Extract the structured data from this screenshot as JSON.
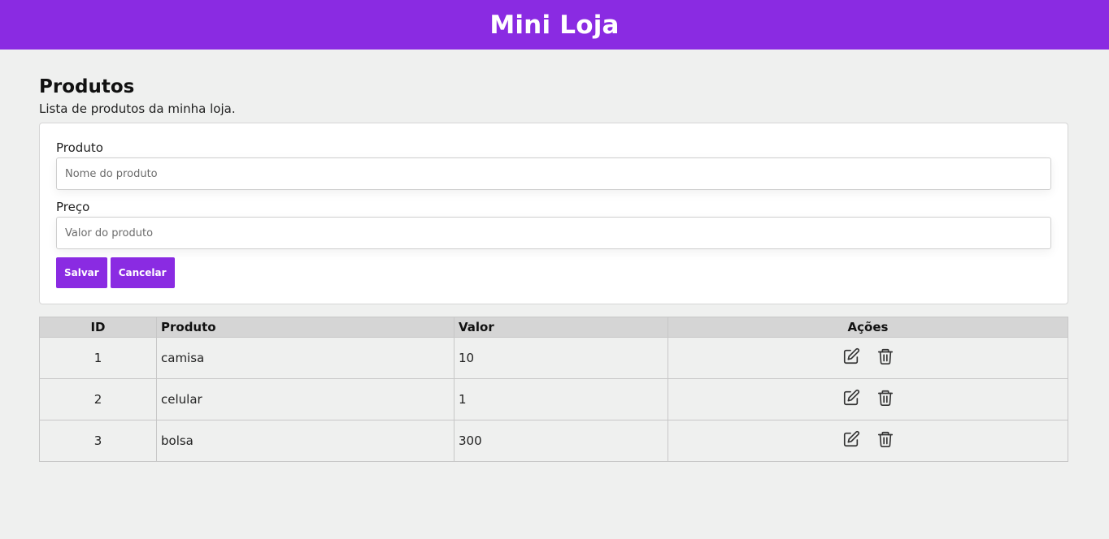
{
  "header": {
    "title": "Mini Loja"
  },
  "page": {
    "title": "Produtos",
    "subtitle": "Lista de produtos da minha loja."
  },
  "form": {
    "product_label": "Produto",
    "product_placeholder": "Nome do produto",
    "product_value": "",
    "price_label": "Preço",
    "price_placeholder": "Valor do produto",
    "price_value": "",
    "save_label": "Salvar",
    "cancel_label": "Cancelar"
  },
  "table": {
    "headers": {
      "id": "ID",
      "product": "Produto",
      "value": "Valor",
      "actions": "Ações"
    },
    "rows": [
      {
        "id": "1",
        "product": "camisa",
        "value": "10"
      },
      {
        "id": "2",
        "product": "celular",
        "value": "1"
      },
      {
        "id": "3",
        "product": "bolsa",
        "value": "300"
      }
    ],
    "row_actions": [
      "edit-icon",
      "trash-icon"
    ]
  },
  "colors": {
    "accent": "#8a2be2",
    "background": "#eff0ef",
    "table_header": "#d5d5d5"
  }
}
